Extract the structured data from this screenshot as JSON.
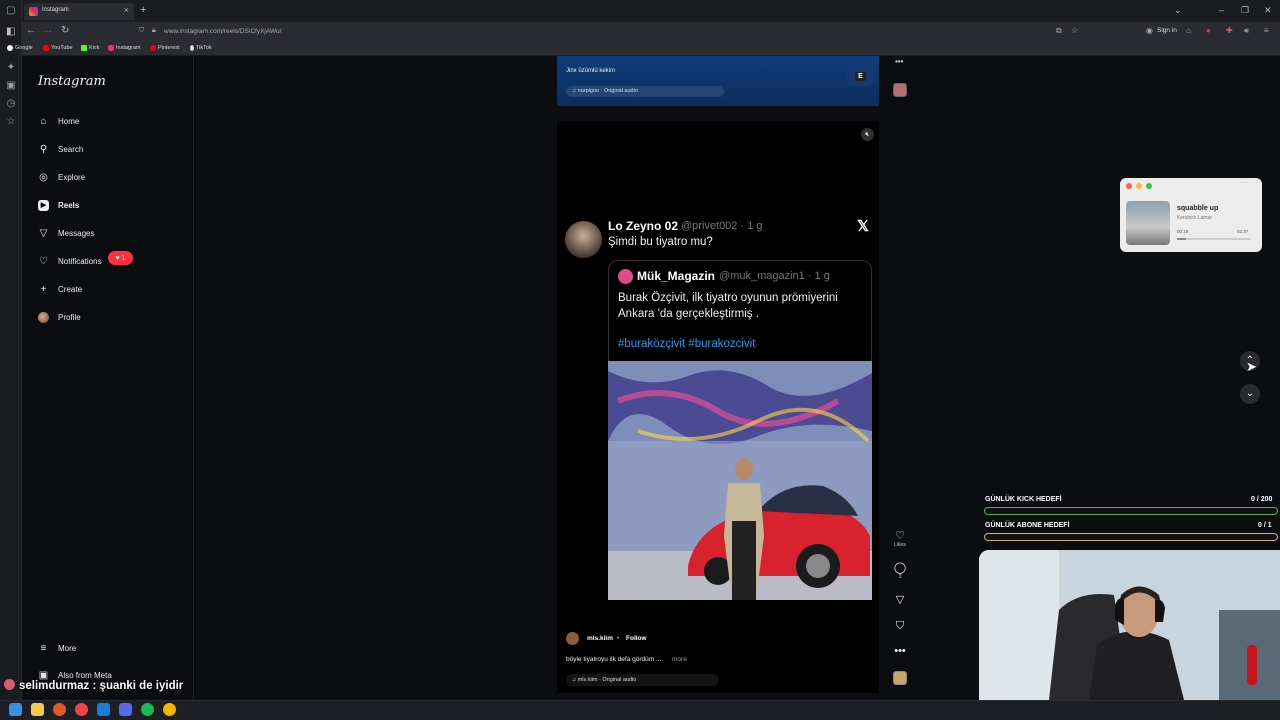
{
  "browser": {
    "tab_title": "Instagram",
    "tab_close": "×",
    "new_tab": "+",
    "url": "www.instagram.com/reels/DSiCfyXjAWu/",
    "sign_in": "Sign in",
    "bookmarks": [
      "Google",
      "YouTube",
      "Kick",
      "Instagram",
      "Pinterest",
      "TikTok"
    ]
  },
  "sidebar": {
    "logo": "Instagram",
    "items": [
      {
        "label": "Home",
        "icon": "home-icon"
      },
      {
        "label": "Search",
        "icon": "search-icon"
      },
      {
        "label": "Explore",
        "icon": "compass-icon"
      },
      {
        "label": "Reels",
        "icon": "reels-icon"
      },
      {
        "label": "Messages",
        "icon": "messages-icon"
      },
      {
        "label": "Notifications",
        "icon": "heart-icon"
      },
      {
        "label": "Create",
        "icon": "plus-icon"
      },
      {
        "label": "Profile",
        "icon": "avatar"
      }
    ],
    "notification_count": "1",
    "more": "More",
    "also_from_meta": "Also from Meta"
  },
  "prev_reel": {
    "caption": "Jinx üzümlü kekim",
    "audio": "narpigoo · Original audio",
    "badge": "E"
  },
  "reel": {
    "tweet": {
      "name": "Lo Zeyno 02",
      "handle": "@privet002 · 1 g",
      "text": "Şimdi bu tiyatro mu?",
      "quote_name": "Mük_Magazin",
      "quote_handle": "@muk_magazin1 · 1 g",
      "quote_text": "Burak Özçivit, ilk tiyatro oyunun prömiyerini Ankara 'da gerçekleştirmiş .",
      "quote_hashtags": "#buraközçivit #burakozcivit"
    },
    "author": "mls.kiim",
    "dot": "•",
    "follow": "Follow",
    "caption": "böyle tiyatroyu ilk defa gördüm ...",
    "more": "more",
    "audio": "mls.kiim · Original audio",
    "likes_label": "Likes",
    "comments_count": "3"
  },
  "music": {
    "title": "squabble up",
    "artist": "Kendrick Lamar",
    "elapsed": "00:19",
    "total": "02:37",
    "progress": 0.12
  },
  "goals": [
    {
      "label": "GÜNLÜK KICK HEDEFİ",
      "count": "0 / 200",
      "color": "#4caf50"
    },
    {
      "label": "GÜNLÜK ABONE HEDEFİ",
      "count": "0 / 1",
      "color": "#c9b27a"
    }
  ],
  "chat": {
    "user": "selimdurmaz",
    "sep": " : ",
    "message": "şuanki de iyidir"
  }
}
